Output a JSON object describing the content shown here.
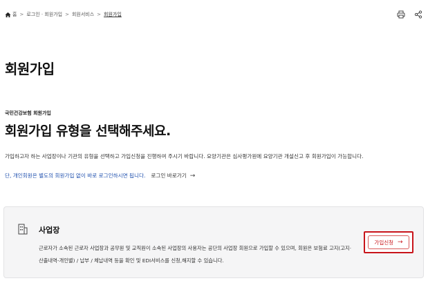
{
  "breadcrumb": {
    "items": [
      "홈",
      "로그인 · 회원가입",
      "회원서비스",
      "회원가입"
    ],
    "separator": ">"
  },
  "actions": {
    "print_icon": "print-icon",
    "share_icon": "share-icon"
  },
  "page": {
    "title": "회원가입"
  },
  "intro": {
    "eyebrow": "국민건강보험 회원가입",
    "headline": "회원가입 유형을 선택해주세요.",
    "description": "가입하고자 하는 사업장이나 기관의 유형을 선택하고 가입신청을 진행하여 주시기 바랍니다. 요양기관은 심사평가원에 요양기관 개설신고 후 회원가입이 가능합니다.",
    "note": "단, 개인회원은 별도의 회원가입 없이 바로 로그인하시면 됩니다.",
    "login_link": "로그인 바로가기",
    "arrow": "→"
  },
  "card": {
    "icon": "building-icon",
    "title": "사업장",
    "description_line1": "근로자가 소속된 근로자 사업장과 공무원 및 교직원이 소속된 사업장의 사용자는 공단의 사업장 회원으로 가입할 수 있으며, 회원은 보험료 고지(고지·",
    "description_line2": "산출내역-개인별) / 납부 / 체납내역 등을 확인 및 EDI서비스를 신청,해지할 수 있습니다.",
    "apply_label": "가입신청",
    "apply_arrow": "→"
  },
  "colors": {
    "accent_red": "#c8141a",
    "link_blue": "#1e4fae",
    "card_bg": "#f5f5f6"
  }
}
